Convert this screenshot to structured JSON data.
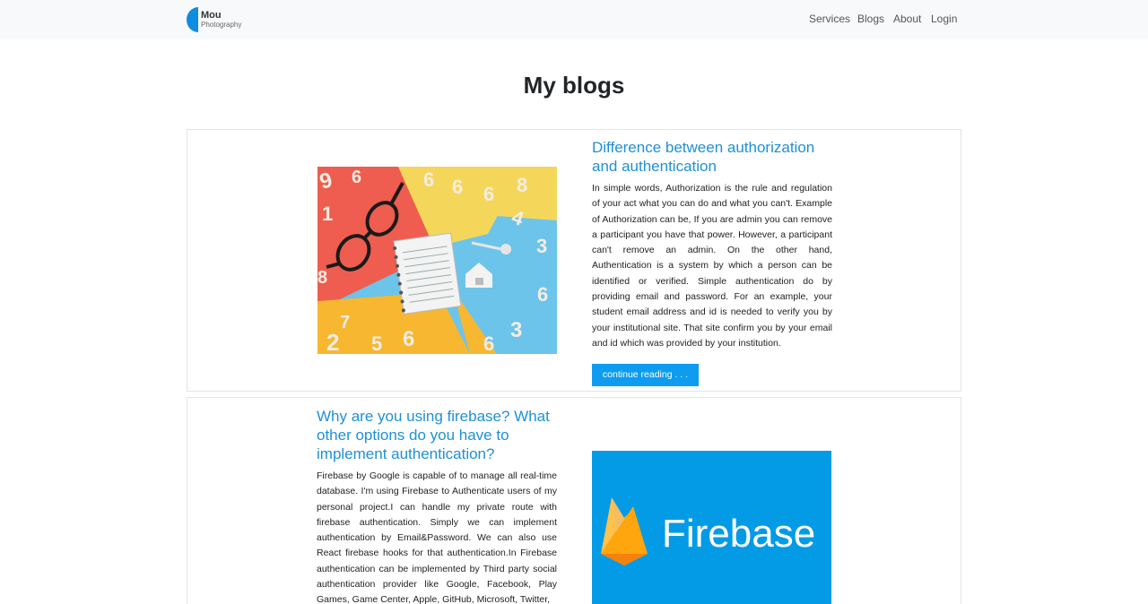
{
  "brand": {
    "name": "Mou",
    "sub": "Photography",
    "accent": "#0d8ce0"
  },
  "nav": {
    "items": [
      "Services",
      "Blogs",
      "About",
      "Login"
    ]
  },
  "page": {
    "title": "My blogs"
  },
  "blogs": [
    {
      "title": "Difference between authorization and authentication",
      "body": "In simple words, Authorization is the rule and regulation of your act what you can do and what you can't. Example of Authorization can be, If you are admin you can remove a participant you have that power. However, a participant can't remove an admin. On the other hand, Authentication is a system by which a person can be identified or verified. Simple authentication do by providing email and password. For an example, your student email address and id is needed to verify you by your institutional site. That site confirm you by your email and id which was provided by your institution.",
      "button": "continue reading . . ."
    },
    {
      "title": "Why are you using firebase? What other options do you have to implement authentication?",
      "body": "Firebase by Google is capable of to manage all real-time database. I'm using Firebase to Authenticate users of my personal project.I can handle my private route with firebase authentication. Simply we can implement authentication by Email&Password. We can also use React firebase hooks for that authentication.In Firebase authentication can be implemented by Third party social authentication provider like Google, Facebook, Play Games, Game Center, Apple, GitHub, Microsoft, Twitter,",
      "image_text": "Firebase"
    }
  ],
  "colors": {
    "link": "#1e90d8",
    "button": "#0d9cf0",
    "firebase_bg": "#039be5"
  }
}
